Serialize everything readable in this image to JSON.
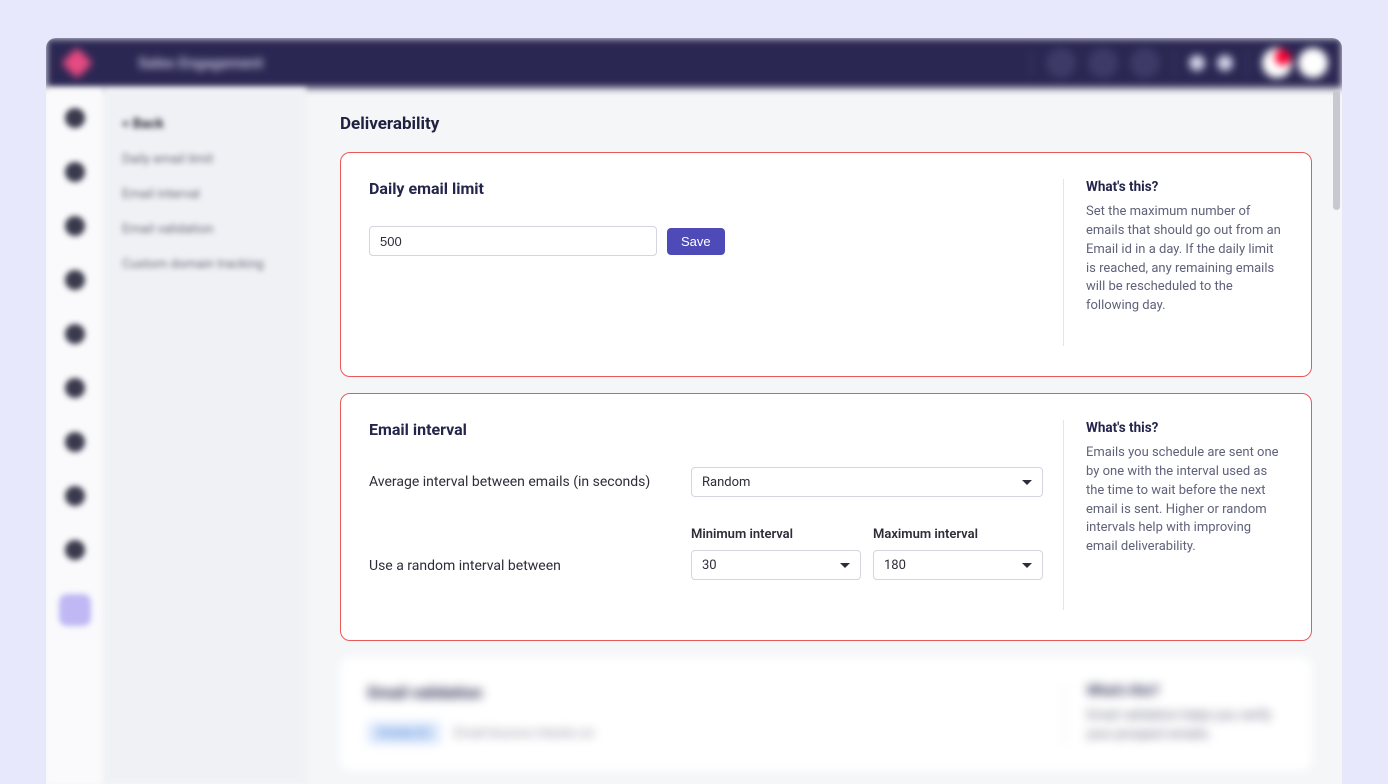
{
  "topbar": {
    "title": "Sales Engagement"
  },
  "sidenav": {
    "back": "< Back",
    "items": [
      "Daily email limit",
      "Email interval",
      "Email validation",
      "Custom domain tracking"
    ]
  },
  "page": {
    "title": "Deliverability"
  },
  "daily_limit": {
    "heading": "Daily email limit",
    "value": "500",
    "save": "Save",
    "help_title": "What's this?",
    "help_text": "Set the maximum number of emails that should go out from an Email id in a day. If the daily limit is reached, any remaining emails will be rescheduled to the following day."
  },
  "interval": {
    "heading": "Email interval",
    "avg_label": "Average interval between emails (in seconds)",
    "mode": "Random",
    "random_label": "Use a random interval between",
    "min_label": "Minimum interval",
    "min_value": "30",
    "max_label": "Maximum interval",
    "max_value": "180",
    "help_title": "What's this?",
    "help_text": "Emails you schedule are sent one by one with the interval used as the time to wait before the next email is sent. Higher or random intervals help with improving email deliverability."
  },
  "validation": {
    "heading": "Email validation",
    "pill": "ENABLED",
    "note": "Email bounce checks on",
    "help_title": "What's this?",
    "help_text": "Email validation helps you verify your prospect emails."
  }
}
